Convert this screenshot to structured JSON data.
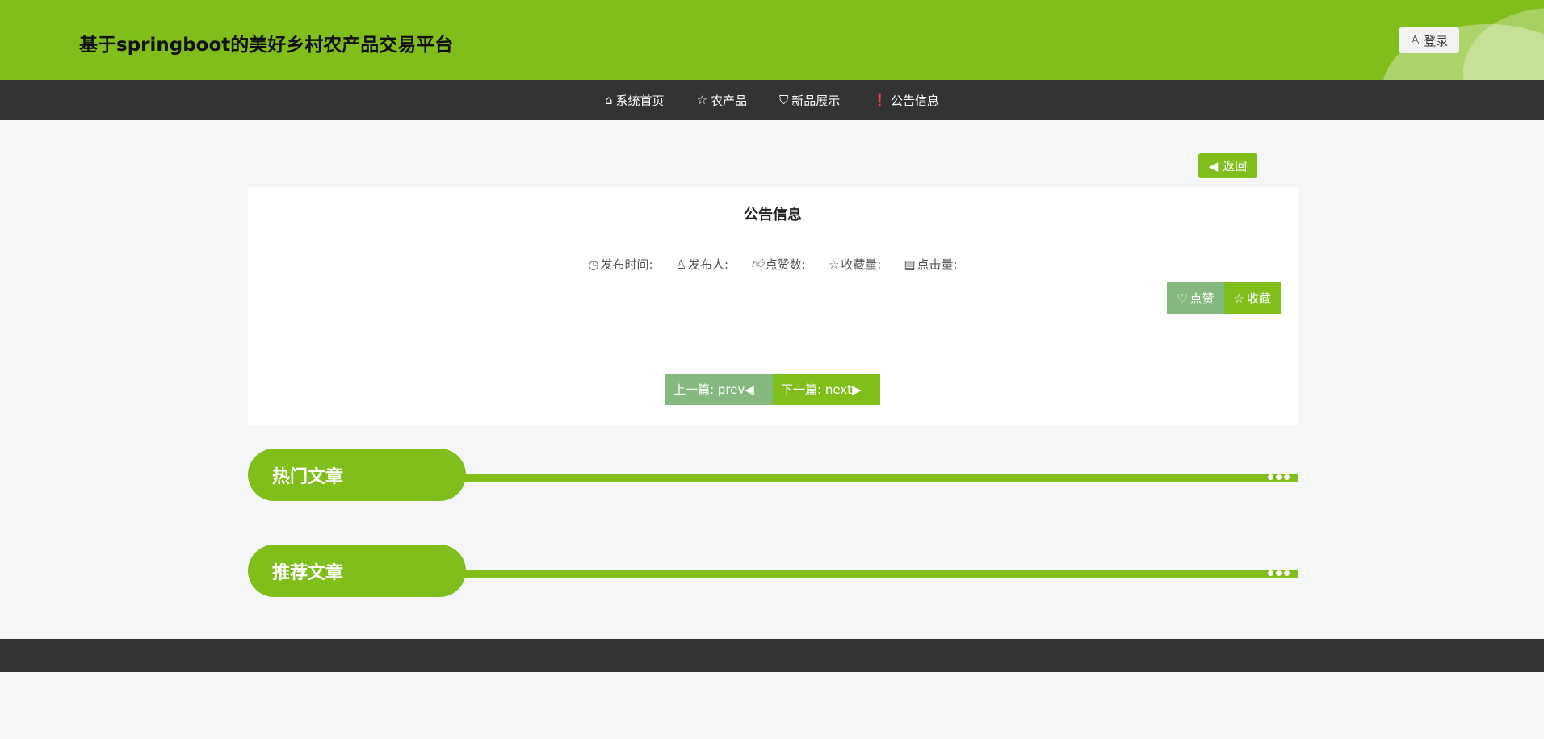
{
  "header": {
    "title": "基于springboot的美好乡村农产品交易平台",
    "login_label": "登录"
  },
  "nav": {
    "items": [
      {
        "icon": "home-icon",
        "label": "系统首页"
      },
      {
        "icon": "star-icon",
        "label": "农产品"
      },
      {
        "icon": "bag-icon",
        "label": "新品展示"
      },
      {
        "icon": "info-icon",
        "label": "公告信息"
      }
    ]
  },
  "back_label": "返回",
  "article": {
    "title": "公告信息",
    "meta": {
      "publish_time": "发布时间:",
      "publisher": "发布人:",
      "likes": "点赞数:",
      "favorites": "收藏量:",
      "clicks": "点击量:"
    },
    "like_label": "点赞",
    "favorite_label": "收藏",
    "prev_label": "上一篇: prev",
    "next_label": "下一篇: next"
  },
  "sections": {
    "hot": "热门文章",
    "recommended": "推荐文章"
  },
  "colors": {
    "brand": "#80be1c",
    "dark": "#333333",
    "muted_green": "#85ba7e"
  }
}
